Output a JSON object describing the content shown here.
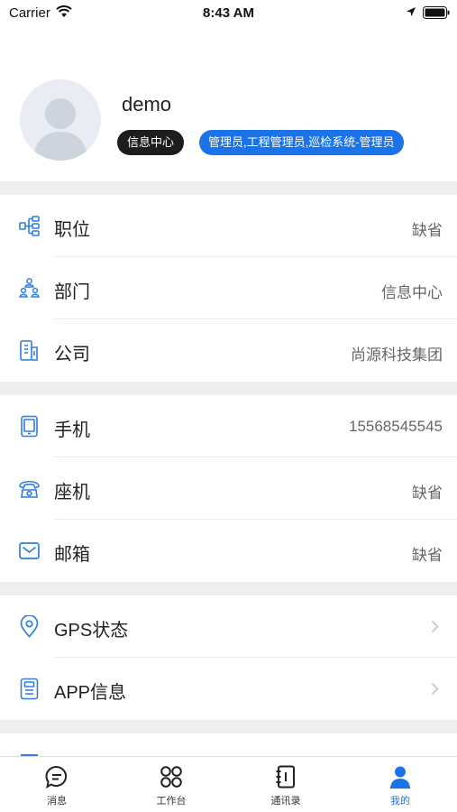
{
  "status_bar": {
    "carrier": "Carrier",
    "time": "8:43 AM"
  },
  "profile": {
    "username": "demo",
    "department_badge": "信息中心",
    "roles_badge": "管理员,工程管理员,巡检系统-管理员"
  },
  "org_section": [
    {
      "label": "职位",
      "value": "缺省",
      "icon": "position-icon"
    },
    {
      "label": "部门",
      "value": "信息中心",
      "icon": "department-icon"
    },
    {
      "label": "公司",
      "value": "尚源科技集团",
      "icon": "company-icon"
    }
  ],
  "contact_section": [
    {
      "label": "手机",
      "value": "15568545545",
      "icon": "mobile-phone-icon"
    },
    {
      "label": "座机",
      "value": "缺省",
      "icon": "landline-phone-icon"
    },
    {
      "label": "邮箱",
      "value": "缺省",
      "icon": "mail-icon"
    }
  ],
  "settings_section": [
    {
      "label": "GPS状态",
      "icon": "location-pin-icon"
    },
    {
      "label": "APP信息",
      "icon": "app-info-icon"
    }
  ],
  "tabbar": {
    "items": [
      {
        "label": "消息",
        "icon": "message-icon",
        "active": false
      },
      {
        "label": "工作台",
        "icon": "workbench-icon",
        "active": false
      },
      {
        "label": "通讯录",
        "icon": "contacts-book-icon",
        "active": false
      },
      {
        "label": "我的",
        "icon": "user-icon",
        "active": true
      }
    ]
  },
  "colors": {
    "accent": "#1a73e8",
    "section_gap": "#eeeeee",
    "department_badge_bg": "#1d1d1d"
  }
}
